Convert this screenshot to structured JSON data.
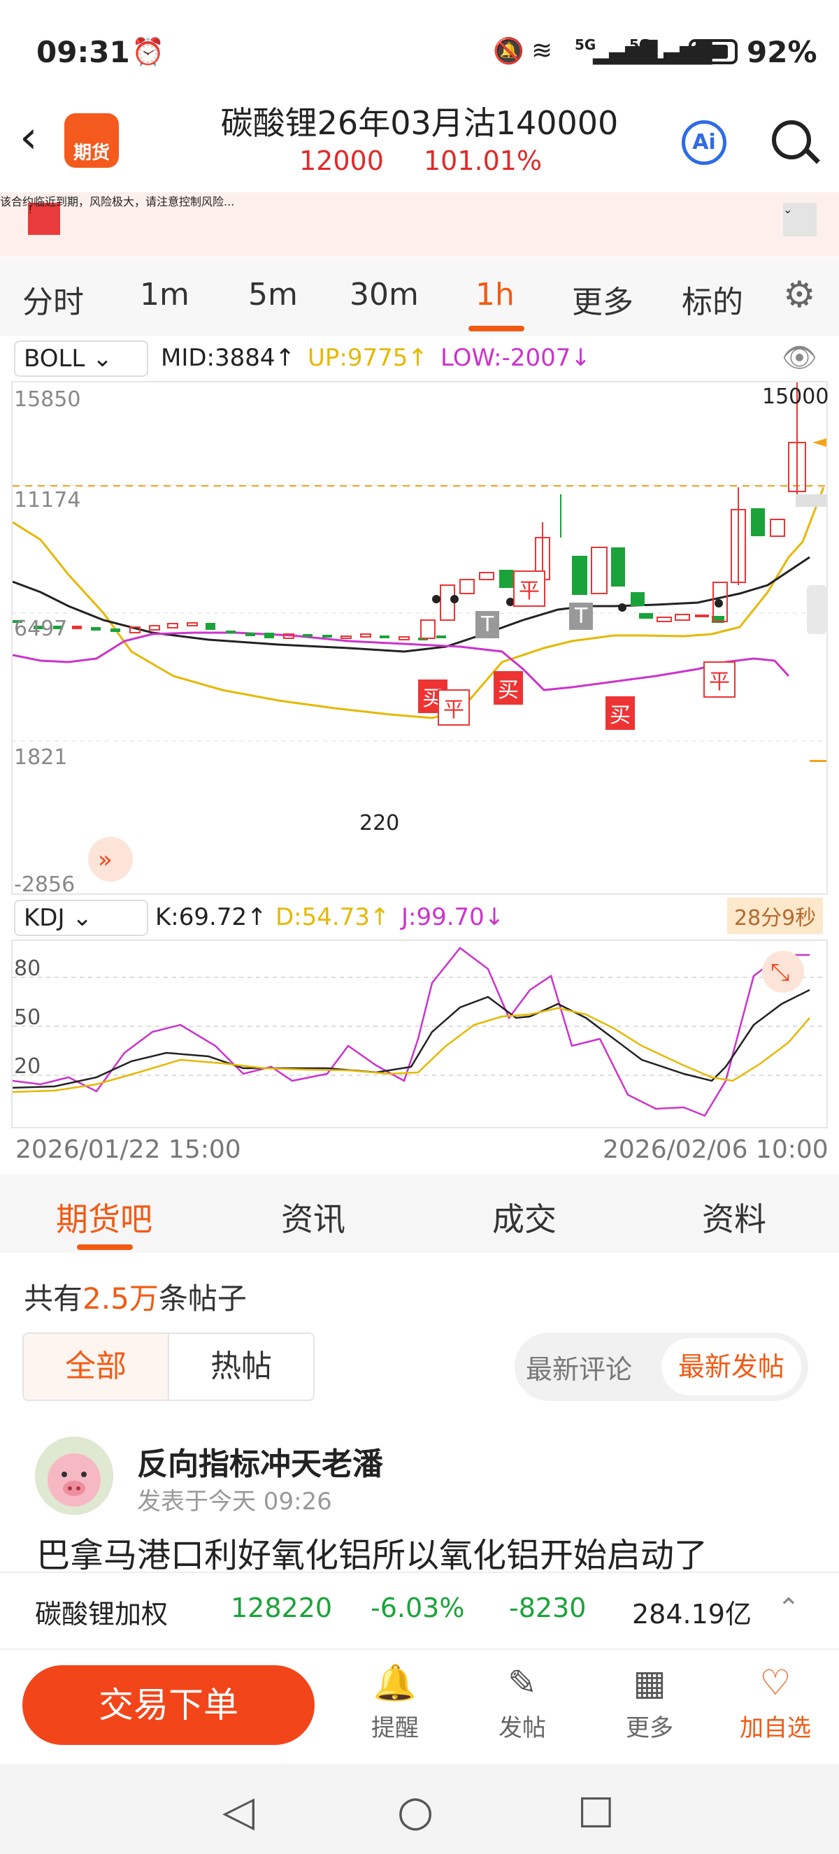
{
  "status": {
    "time": "09:31",
    "battery": "92%",
    "signal1": "5G",
    "signal2": "5G"
  },
  "header": {
    "logo": "期货",
    "title": "碳酸锂26年03月沽140000",
    "price": "12000",
    "change": "101.01%",
    "ai": "Ai"
  },
  "warning": {
    "text": "该合约临近到期，风险极大，请注意控制风险..."
  },
  "tabs": [
    "分时",
    "1m",
    "5m",
    "30m",
    "1h",
    "更多",
    "标的"
  ],
  "indicator": {
    "name": "BOLL",
    "mid": "MID:3884↑",
    "up": "UP:9775↑",
    "low": "LOW:-2007↓",
    "colors": {
      "mid": "#222222",
      "up": "#e6b800",
      "low": "#cc33cc"
    }
  },
  "chart_axis": {
    "y": [
      "15850",
      "11174",
      "6497",
      "1821",
      "-2856"
    ],
    "max_label": "15000",
    "min_label": "220"
  },
  "markers": [
    "买",
    "平",
    "买",
    "平",
    "买",
    "平",
    "T",
    "T"
  ],
  "kdj": {
    "name": "KDJ",
    "k": "K:69.72↑",
    "d": "D:54.73↑",
    "j": "J:99.70↓",
    "timer": "28分9秒",
    "y": [
      "80",
      "50",
      "20"
    ]
  },
  "dates": {
    "start": "2026/01/22 15:00",
    "end": "2026/02/06 10:00"
  },
  "chart_data": {
    "type": "candlestick",
    "series": [
      {
        "name": "MID",
        "values": []
      },
      {
        "name": "UP",
        "values": []
      },
      {
        "name": "LOW",
        "values": []
      }
    ],
    "ylim": [
      -2856,
      15850
    ]
  },
  "section_tabs": [
    "期货吧",
    "资讯",
    "成交",
    "资料"
  ],
  "posts": {
    "count_prefix": "共有",
    "count": "2.5万",
    "count_suffix": "条帖子",
    "seg_all": "全部",
    "seg_hot": "热帖",
    "sort_a": "最新评论",
    "sort_b": "最新发帖"
  },
  "post": {
    "user": "反向指标冲天老潘",
    "time": "发表于今天 09:26",
    "content": "巴拿马港口利好氧化铝所以氧化铝开始启动了"
  },
  "ticker": {
    "name": "碳酸锂加权",
    "price": "128220",
    "pct": "-6.03%",
    "chg": "-8230",
    "vol": "284.19亿"
  },
  "bottom": {
    "trade": "交易下单",
    "remind": "提醒",
    "post": "发帖",
    "more": "更多",
    "fav": "加自选"
  }
}
